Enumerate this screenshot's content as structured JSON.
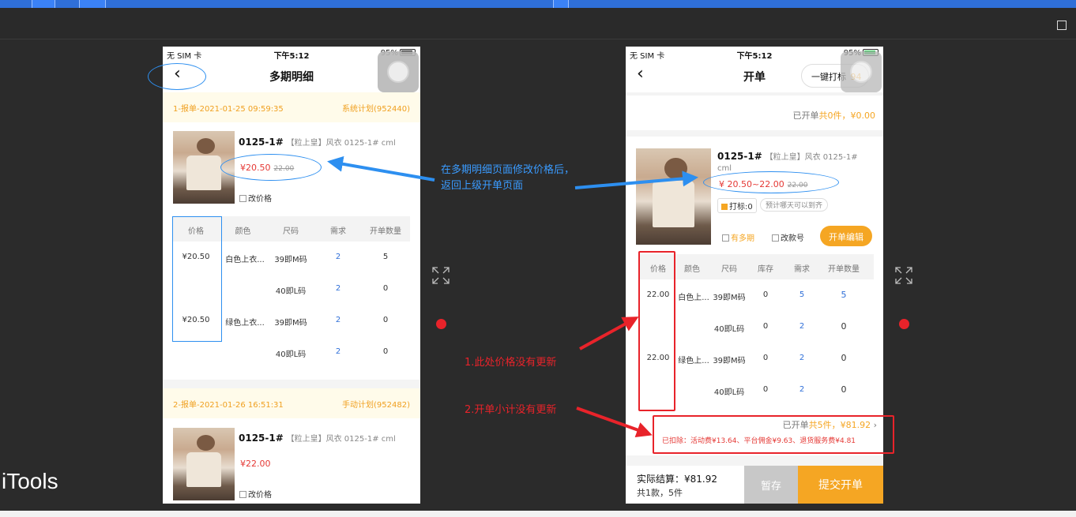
{
  "brand": "iTools",
  "left_phone": {
    "status": {
      "carrier": "无 SIM 卡",
      "time": "下午5:12",
      "battery": "95%"
    },
    "nav_title": "多期明细",
    "orders": [
      {
        "label": "1-报单-2021-01-25 09:59:35",
        "plan": "系统计划(952440)",
        "product_code": "0125-1#",
        "product_desc": "【粒上皇】风衣  0125-1#  cml",
        "price": "¥20.50",
        "old_price": "22.00",
        "edit_label": "改价格"
      },
      {
        "label": "2-报单-2021-01-26 16:51:31",
        "plan": "手动计划(952482)",
        "product_code": "0125-1#",
        "product_desc": "【粒上皇】风衣  0125-1#  cml",
        "price": "¥22.00",
        "edit_label": "改价格"
      }
    ],
    "table": {
      "headers": [
        "价格",
        "颜色",
        "尺码",
        "需求",
        "开单数量"
      ],
      "rows": [
        [
          "¥20.50",
          "白色上衣...",
          "39即M码",
          "2",
          "5"
        ],
        [
          "",
          "",
          "40即L码",
          "2",
          "0"
        ],
        [
          "¥20.50",
          "绿色上衣...",
          "39即M码",
          "2",
          "0"
        ],
        [
          "",
          "",
          "40即L码",
          "2",
          "0"
        ]
      ]
    }
  },
  "right_phone": {
    "status": {
      "carrier": "无 SIM 卡",
      "time": "下午5:12",
      "battery": "95%"
    },
    "nav_title": "开单",
    "tag_button": "一键打标",
    "tag_count": "94",
    "summary_top": {
      "prefix": "已开单",
      "count": "共0件，",
      "amount": "¥0.00"
    },
    "product": {
      "code": "0125-1#",
      "desc": "【粒上皇】风衣  0125-1#",
      "desc2": "cml",
      "price": "¥ 20.50~22.00",
      "old_price": "22.00",
      "tag_label": "打标:0",
      "chip": "预计哪天可以到齐",
      "multi": "有多期",
      "change": "改款号",
      "edit_button": "开单编辑"
    },
    "table": {
      "headers": [
        "价格",
        "颜色",
        "尺码",
        "库存",
        "需求",
        "开单数量"
      ],
      "rows": [
        [
          "22.00",
          "白色上...",
          "39即M码",
          "0",
          "5",
          "5"
        ],
        [
          "",
          "",
          "40即L码",
          "0",
          "2",
          "0"
        ],
        [
          "22.00",
          "绿色上...",
          "39即M码",
          "0",
          "2",
          "0"
        ],
        [
          "",
          "",
          "40即L码",
          "0",
          "2",
          "0"
        ]
      ]
    },
    "subtotal": {
      "prefix": "已开单",
      "count": "共5件，",
      "amount": "¥81.92",
      "deductions": "已扣除：活动费¥13.64、平台佣金¥9.63、退货服务费¥4.81"
    },
    "footer": {
      "settle_label": "实际结算：¥81.92",
      "count_label": "共1款，5件",
      "save_button": "暂存",
      "submit_button": "提交开单"
    }
  },
  "annotations": {
    "blue_note_line1": "在多期明细页面修改价格后，",
    "blue_note_line2": "返回上级开单页面",
    "red_note_1": "1.此处价格没有更新",
    "red_note_2": "2.开单小计没有更新"
  },
  "colors": {
    "accent_orange": "#f5a623",
    "price_red": "#e53935",
    "annotation_blue": "#2d8ff0",
    "annotation_red": "#e8232a"
  }
}
